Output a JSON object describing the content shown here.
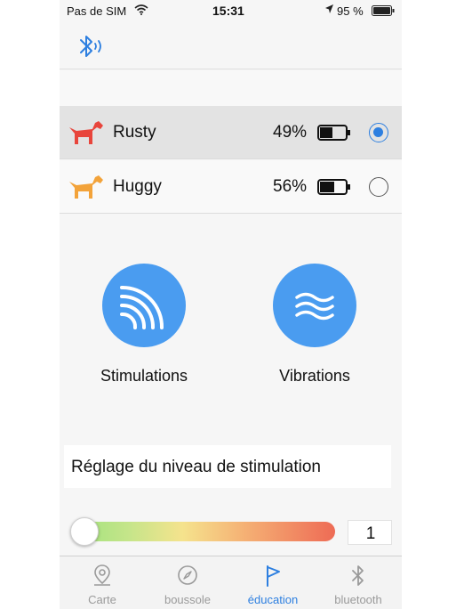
{
  "status_bar": {
    "carrier": "Pas de SIM",
    "time": "15:31",
    "battery": "95 %"
  },
  "dogs": [
    {
      "name": "Rusty",
      "battery": "49%",
      "battery_fill": 0.49,
      "color": "#e8453c",
      "selected": true
    },
    {
      "name": "Huggy",
      "battery": "56%",
      "battery_fill": 0.56,
      "color": "#f3a33a",
      "selected": false
    }
  ],
  "modes": {
    "stimulations": {
      "label": "Stimulations",
      "icon": "signal-waves-icon"
    },
    "vibrations": {
      "label": "Vibrations",
      "icon": "vibration-waves-icon"
    }
  },
  "level": {
    "title": "Réglage du niveau de stimulation",
    "value": "1"
  },
  "tabs": [
    {
      "label": "Carte",
      "icon": "map-pin-icon",
      "active": false
    },
    {
      "label": "boussole",
      "icon": "compass-icon",
      "active": false
    },
    {
      "label": "éducation",
      "icon": "flag-icon",
      "active": true
    },
    {
      "label": "bluetooth",
      "icon": "bluetooth-icon",
      "active": false
    }
  ],
  "colors": {
    "accent": "#2d7fe0",
    "mode_button": "#4a9cf0"
  }
}
